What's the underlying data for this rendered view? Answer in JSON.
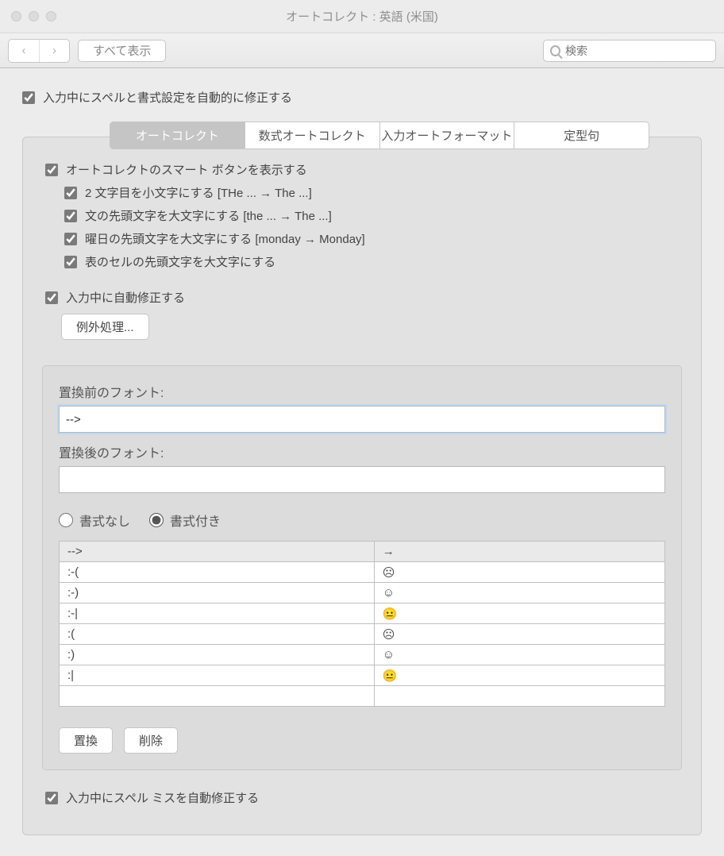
{
  "window": {
    "title": "オートコレクト : 英語 (米国)"
  },
  "toolbar": {
    "show_all": "すべて表示",
    "search_placeholder": "検索"
  },
  "main_checkbox": "入力中にスペルと書式設定を自動的に修正する",
  "tabs": [
    "オートコレクト",
    "数式オートコレクト",
    "入力オートフォーマット",
    "定型句"
  ],
  "options": {
    "smart_button": "オートコレクトのスマート ボタンを表示する",
    "second_char": "2 文字目を小文字にする [THe ... → The ...]",
    "sentence_cap": "文の先頭文字を大文字にする [the ... → The ...]",
    "day_cap": "曜日の先頭文字を大文字にする [monday →    Monday]",
    "table_cap": "表のセルの先頭文字を大文字にする",
    "auto_correct": "入力中に自動修正する",
    "exceptions_btn": "例外処理...",
    "spell_correct": "入力中にスペル ミスを自動修正する"
  },
  "fields": {
    "before_label": "置換前のフォント:",
    "before_value": "-->",
    "after_label": "置換後のフォント:",
    "after_value": ""
  },
  "radios": {
    "plain": "書式なし",
    "rich": "書式付き"
  },
  "table": {
    "rows": [
      {
        "from": "-->",
        "to": "→"
      },
      {
        "from": ":-(",
        "to": "☹"
      },
      {
        "from": ":-)",
        "to": "☺"
      },
      {
        "from": ":-|",
        "to": "😐"
      },
      {
        "from": ":(",
        "to": "☹"
      },
      {
        "from": ":)",
        "to": "☺"
      },
      {
        "from": ":|",
        "to": "😐"
      },
      {
        "from": "",
        "to": ""
      }
    ]
  },
  "buttons": {
    "replace": "置換",
    "delete": "削除"
  }
}
